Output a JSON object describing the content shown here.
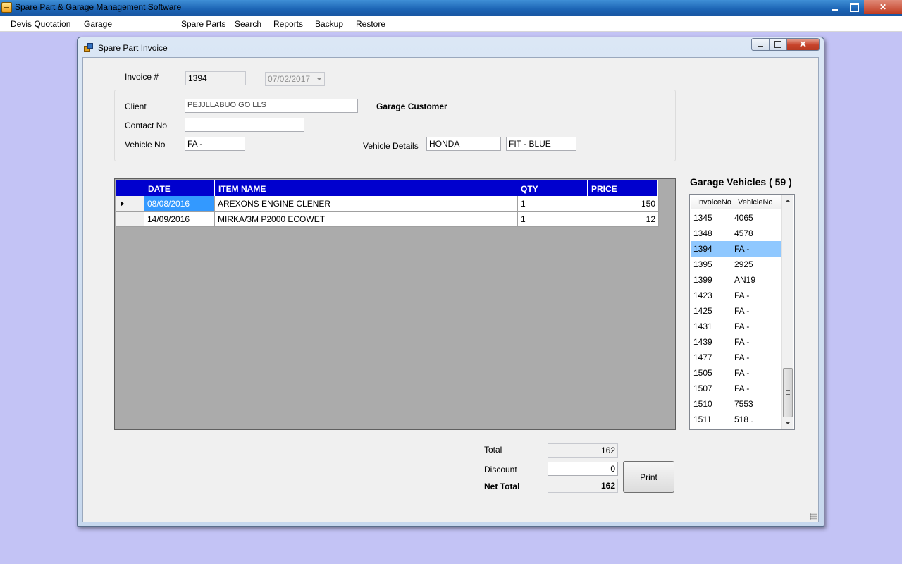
{
  "app": {
    "title": "Spare Part & Garage Management Software"
  },
  "menu": [
    "Devis Quotation",
    "Garage",
    "Spare Parts",
    "Search",
    "Reports",
    "Backup",
    "Restore"
  ],
  "child": {
    "title": "Spare Part Invoice",
    "close_glyph": "✕"
  },
  "invoice": {
    "invoice_label": "Invoice #",
    "invoice_no": "1394",
    "date": "07/02/2017",
    "client_label": "Client",
    "client_value": "PEJJLLABUO GO LLS",
    "garage_customer": "Garage Customer",
    "contact_label": "Contact No",
    "contact_value": "",
    "vehicle_no_label": "Vehicle No",
    "vehicle_no_value": "FA -",
    "vehicle_details_label": "Vehicle Details",
    "vehicle_make": "HONDA",
    "vehicle_model": "FIT - BLUE"
  },
  "items": {
    "columns": [
      "DATE",
      "ITEM NAME",
      "QTY",
      "PRICE"
    ],
    "rows": [
      {
        "date": "08/08/2016",
        "item": "AREXONS ENGINE CLENER",
        "qty": "1",
        "price": "150"
      },
      {
        "date": "14/09/2016",
        "item": "MIRKA/3M P2000 ECOWET",
        "qty": "1",
        "price": "12"
      }
    ]
  },
  "vehicles": {
    "title": "Garage Vehicles ( 59 )",
    "columns": [
      "InvoiceNo",
      "VehicleNo"
    ],
    "rows": [
      {
        "invoice": "1345",
        "vehicle": "4065"
      },
      {
        "invoice": "1348",
        "vehicle": "4578"
      },
      {
        "invoice": "1394",
        "vehicle": "FA -"
      },
      {
        "invoice": "1395",
        "vehicle": "2925"
      },
      {
        "invoice": "1399",
        "vehicle": "AN19"
      },
      {
        "invoice": "1423",
        "vehicle": "FA -"
      },
      {
        "invoice": "1425",
        "vehicle": "FA -"
      },
      {
        "invoice": "1431",
        "vehicle": "FA -"
      },
      {
        "invoice": "1439",
        "vehicle": "FA -"
      },
      {
        "invoice": "1477",
        "vehicle": "FA -"
      },
      {
        "invoice": "1505",
        "vehicle": "FA -"
      },
      {
        "invoice": "1507",
        "vehicle": "FA -"
      },
      {
        "invoice": "1510",
        "vehicle": "7553"
      },
      {
        "invoice": "1511",
        "vehicle": "518 ."
      }
    ]
  },
  "totals": {
    "total_label": "Total",
    "total_value": "162",
    "discount_label": "Discount",
    "discount_value": "0",
    "net_label": "Net Total",
    "net_value": "162",
    "print_label": "Print"
  }
}
